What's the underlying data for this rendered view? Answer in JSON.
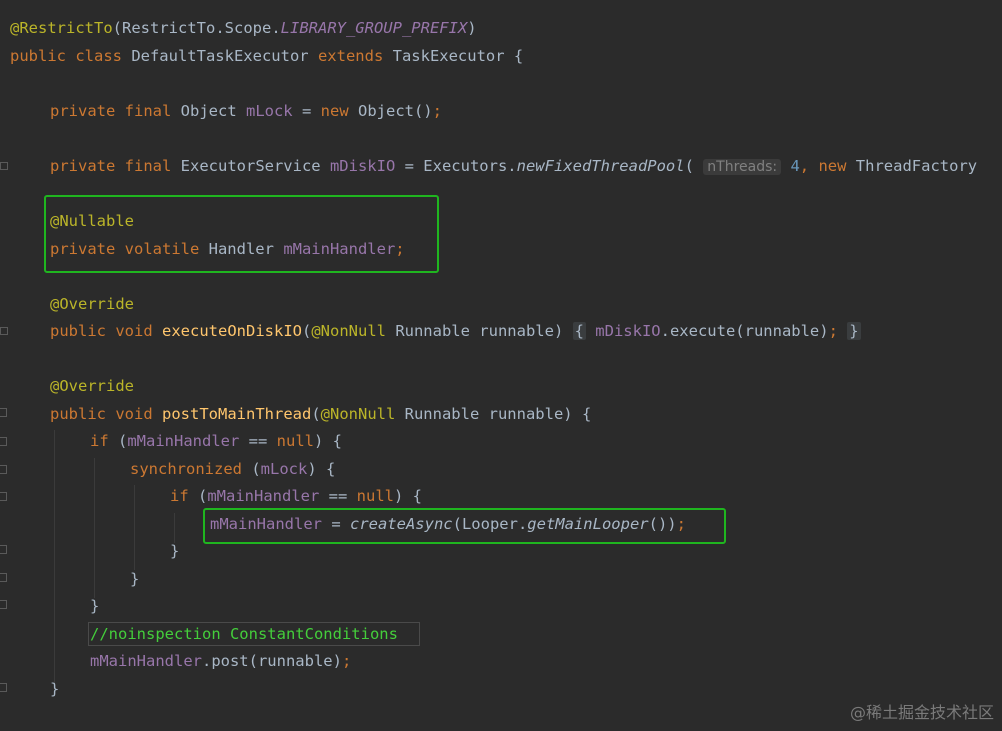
{
  "code": {
    "line1": {
      "annotation": "@RestrictTo",
      "open": "(",
      "cls": "RestrictTo",
      "dot": ".Scope.",
      "constant": "LIBRARY_GROUP_PREFIX",
      "close": ")"
    },
    "line2": {
      "kw1": "public class",
      "name": " DefaultTaskExecutor ",
      "kw2": "extends",
      "rest": " TaskExecutor {"
    },
    "line3": {
      "kw": "private final",
      "type": " Object ",
      "field": "mLock",
      "eq": " = ",
      "kwnew": "new",
      "rest": " Object()",
      "semi": ";"
    },
    "line4": {
      "kw": "private final",
      "type": " ExecutorService ",
      "field": "mDiskIO",
      "eq": " = Executors.",
      "method": "newFixedThreadPool",
      "open": "( ",
      "hint": "nThreads:",
      "num": " 4",
      "comma": ", ",
      "kwnew": "new",
      "rest": " ThreadFactory"
    },
    "line5": {
      "annotation": "@Nullable"
    },
    "line6": {
      "kw": "private volatile",
      "type": " Handler ",
      "field": "mMainHandler",
      "semi": ";"
    },
    "line7": {
      "annotation": "@Override"
    },
    "line8": {
      "kw": "public void",
      "sp": " ",
      "fn": "executeOnDiskIO",
      "open": "(",
      "annotation": "@NonNull",
      "params": " Runnable runnable) ",
      "fold_open": "{",
      "field": " mDiskIO",
      "call": ".execute(runnable)",
      "semi": ";",
      "fold_close": "}"
    },
    "line9": {
      "annotation": "@Override"
    },
    "line10": {
      "kw": "public void",
      "sp": " ",
      "fn": "postToMainThread",
      "open": "(",
      "annotation": "@NonNull",
      "params": " Runnable runnable) {"
    },
    "line11": {
      "kw": "if",
      "open": " (",
      "field": "mMainHandler",
      "op": " == ",
      "kwnull": "null",
      "rest": ") {"
    },
    "line12": {
      "kw": "synchronized",
      "open": " (",
      "field": "mLock",
      "rest": ") {"
    },
    "line13": {
      "kw": "if",
      "open": " (",
      "field": "mMainHandler",
      "op": " == ",
      "kwnull": "null",
      "rest": ") {"
    },
    "line14": {
      "field": "mMainHandler",
      "eq": " = ",
      "method": "createAsync",
      "open": "(Looper.",
      "method2": "getMainLooper",
      "close": "())",
      "semi": ";"
    },
    "line15": {
      "brace": "}"
    },
    "line16": {
      "brace": "}"
    },
    "line17": {
      "brace": "}"
    },
    "line18": {
      "comment": "//noinspection ConstantConditions"
    },
    "line19": {
      "field": "mMainHandler",
      "call": ".post(runnable)",
      "semi": ";"
    },
    "line20": {
      "brace": "}"
    }
  },
  "colors": {
    "background": "#2b2b2b",
    "highlight_box": "#1fb51f"
  },
  "watermark": "@稀土掘金技术社区"
}
